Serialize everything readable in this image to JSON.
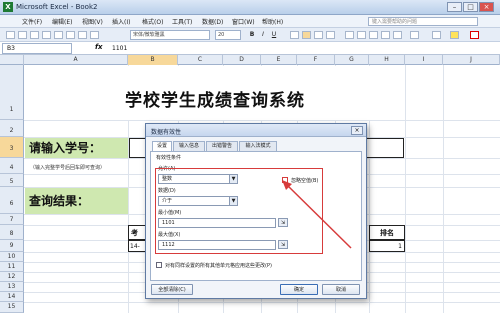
{
  "window": {
    "app_icon": "X",
    "title": "Microsoft Excel - Book2",
    "buttons": [
      "–",
      "□",
      "×"
    ]
  },
  "menu": {
    "items": [
      "文件(F)",
      "编辑(E)",
      "视图(V)",
      "插入(I)",
      "格式(O)",
      "工具(T)",
      "数据(D)",
      "窗口(W)",
      "帮助(H)"
    ],
    "help_placeholder": "键入需要帮助的问题"
  },
  "toolbar": {
    "font_name": "宋体/微软雅黑",
    "font_size": "20",
    "bold": "B",
    "italic": "I",
    "underline": "U"
  },
  "formula_bar": {
    "name_box": "B3",
    "fx": "fx",
    "value": "1101"
  },
  "grid": {
    "columns": [
      "A",
      "B",
      "C",
      "D",
      "E",
      "F",
      "G",
      "H",
      "I",
      "J"
    ],
    "rows": [
      "1",
      "2",
      "3",
      "4",
      "5",
      "6",
      "7",
      "8",
      "9",
      "10",
      "11",
      "12",
      "13",
      "14",
      "15"
    ],
    "selected_column": "B",
    "selected_row": "3"
  },
  "sheet": {
    "title": "学校学生成绩查询系统",
    "input_label": "请输入学号：",
    "hint": "（输入完整学号后回车即可查询）",
    "result_label": "查询结果：",
    "header_partial": "考",
    "rank_header": "排名",
    "row9_partial": "14-",
    "row9_rank": "1"
  },
  "dialog": {
    "title": "数据有效性",
    "close": "×",
    "tabs": [
      "设置",
      "输入信息",
      "出错警告",
      "输入法模式"
    ],
    "active_tab": "设置",
    "section_label": "有效性条件",
    "allow_label": "允许(A)",
    "allow_value": "整数",
    "ignore_blank": "忽略空值(B)",
    "ignore_blank_checked": true,
    "data_label": "数据(D)",
    "data_value": "介于",
    "min_label": "最小值(M)",
    "min_value": "1101",
    "max_label": "最大值(X)",
    "max_value": "1112",
    "apply_all": "对有同样设置的所有其他单元格应用这些更改(P)",
    "clear_all": "全部清除(C)",
    "ok": "确定",
    "cancel": "取消"
  },
  "colors": {
    "annotation_red": "#d73b3b",
    "green_fill": "#cfe8b0",
    "selection": "#f7d89a"
  }
}
